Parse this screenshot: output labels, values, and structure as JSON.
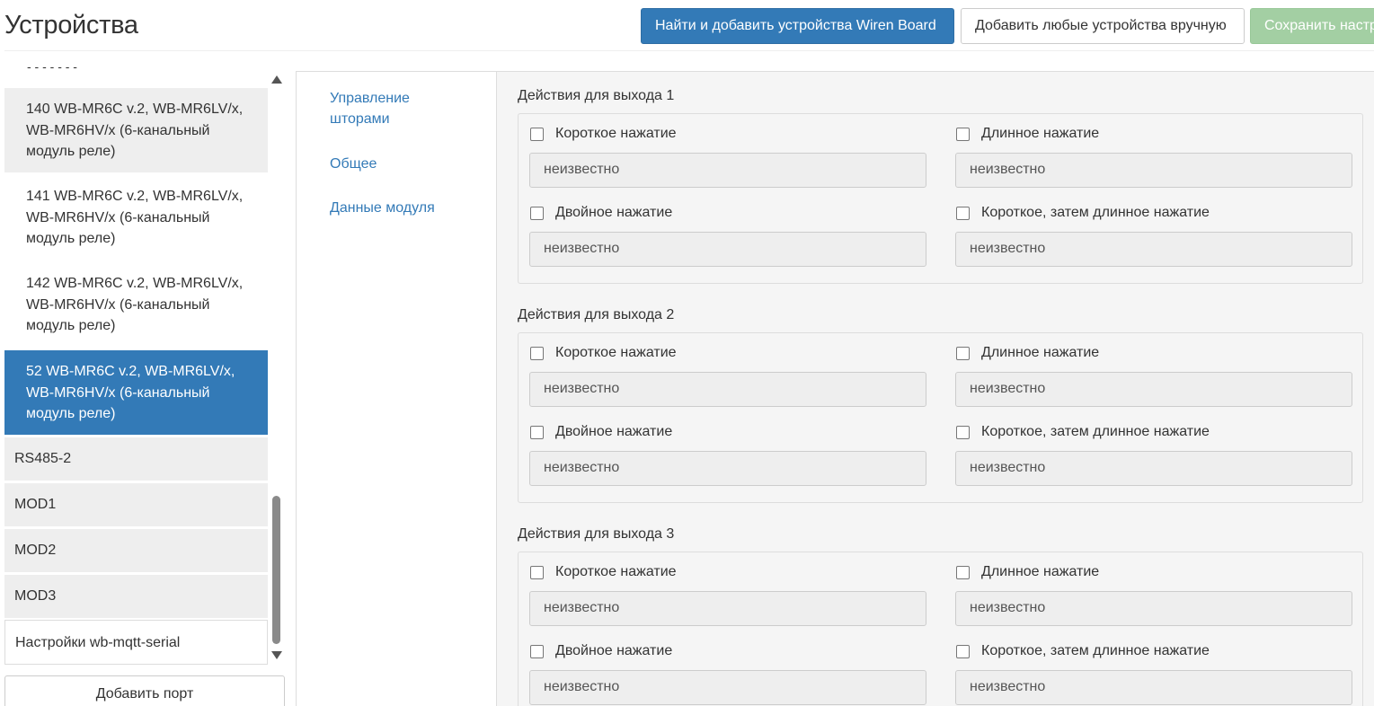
{
  "header": {
    "title": "Устройства",
    "btn_scan": "Найти и добавить устройства Wiren Board",
    "btn_manual": "Добавить любые устройства вручную",
    "btn_save": "Сохранить настройки"
  },
  "sidebar": {
    "items": [
      {
        "label": "140 WB-MR6C v.2, WB-MR6LV/x, WB-MR6HV/x (6-канальный модуль реле)"
      },
      {
        "label": "141 WB-MR6C v.2, WB-MR6LV/x, WB-MR6HV/x (6-канальный модуль реле)"
      },
      {
        "label": "142 WB-MR6C v.2, WB-MR6LV/x, WB-MR6HV/x (6-канальный модуль реле)"
      },
      {
        "label": "52 WB-MR6C v.2, WB-MR6LV/x, WB-MR6HV/x (6-канальный модуль реле)"
      }
    ],
    "ports": [
      "RS485-2",
      "MOD1",
      "MOD2",
      "MOD3"
    ],
    "settings_label": "Настройки wb-mqtt-serial",
    "add_port": "Добавить порт"
  },
  "tabs": [
    "Управление шторами",
    "Общее",
    "Данные модуля"
  ],
  "groups": [
    {
      "title": "Действия для выхода 1",
      "fields": [
        {
          "label": "Короткое нажатие",
          "value": "неизвестно"
        },
        {
          "label": "Длинное нажатие",
          "value": "неизвестно"
        },
        {
          "label": "Двойное нажатие",
          "value": "неизвестно"
        },
        {
          "label": "Короткое, затем длинное нажатие",
          "value": "неизвестно"
        }
      ]
    },
    {
      "title": "Действия для выхода 2",
      "fields": [
        {
          "label": "Короткое нажатие",
          "value": "неизвестно"
        },
        {
          "label": "Длинное нажатие",
          "value": "неизвестно"
        },
        {
          "label": "Двойное нажатие",
          "value": "неизвестно"
        },
        {
          "label": "Короткое, затем длинное нажатие",
          "value": "неизвестно"
        }
      ]
    },
    {
      "title": "Действия для выхода 3",
      "fields": [
        {
          "label": "Короткое нажатие",
          "value": "неизвестно"
        },
        {
          "label": "Длинное нажатие",
          "value": "неизвестно"
        },
        {
          "label": "Двойное нажатие",
          "value": "неизвестно"
        },
        {
          "label": "Короткое, затем длинное нажатие",
          "value": "неизвестно"
        }
      ]
    }
  ],
  "colors": {
    "primary": "#337ab7",
    "success_disabled": "#a3cfa3",
    "active_item": "#337ab7"
  }
}
